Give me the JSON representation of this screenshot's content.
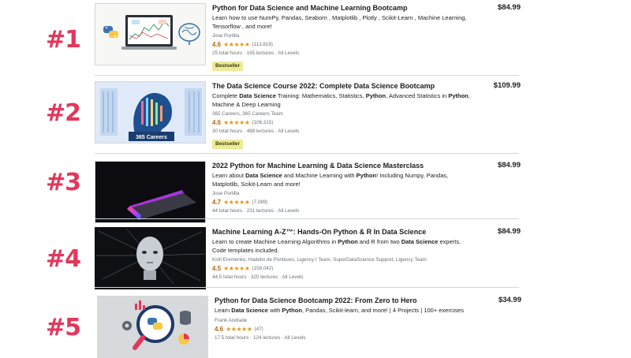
{
  "courses": [
    {
      "rank": "#1",
      "title": "Python for Data Science and Machine Learning Bootcamp",
      "desc": [
        {
          "t": "Learn how to use NumPy, Pandas, Seaborn , Matplotlib , Plotly , Scikit-Learn , Machine Learning, Tensorflow , and more!",
          "b": false
        }
      ],
      "instructor": "Jose Portilla",
      "rating": "4.6",
      "stars": "★★★★★",
      "rating_count": "(113,818)",
      "meta": "25 total hours · 165 lectures · All Levels",
      "badge": "Bestseller",
      "price": "$84.99"
    },
    {
      "rank": "#2",
      "title": "The Data Science Course 2022: Complete Data Science Bootcamp",
      "desc": [
        {
          "t": "Complete ",
          "b": false
        },
        {
          "t": "Data Science",
          "b": true
        },
        {
          "t": " Training: Mathematics, Statistics, ",
          "b": false
        },
        {
          "t": "Python",
          "b": true
        },
        {
          "t": ", Advanced Statistics in ",
          "b": false
        },
        {
          "t": "Python",
          "b": true
        },
        {
          "t": ", Machine & Deep Learning",
          "b": false
        }
      ],
      "thumb_label": "365 Careers",
      "instructor": "365 Careers, 365 Careers Team",
      "rating": "4.6",
      "stars": "★★★★★",
      "rating_count": "(106,315)",
      "meta": "30 total hours · 488 lectures · All Levels",
      "badge": "Bestseller",
      "price": "$109.99"
    },
    {
      "rank": "#3",
      "title": "2022 Python for Machine Learning & Data Science Masterclass",
      "desc": [
        {
          "t": "Learn about ",
          "b": false
        },
        {
          "t": "Data Science",
          "b": true
        },
        {
          "t": " and Machine Learning with ",
          "b": false
        },
        {
          "t": "Python",
          "b": true
        },
        {
          "t": "! Including Numpy, Pandas, Matplotlib, Scikit-Learn and more!",
          "b": false
        }
      ],
      "instructor": "Jose Portilla",
      "rating": "4.7",
      "stars": "★★★★★",
      "rating_count": "(7,089)",
      "meta": "44 total hours · 231 lectures · All Levels",
      "badge": "",
      "price": "$84.99"
    },
    {
      "rank": "#4",
      "title": "Machine Learning A-Z™: Hands-On Python & R In Data Science",
      "desc": [
        {
          "t": "Learn to create Machine Learning Algorithms in ",
          "b": false
        },
        {
          "t": "Python",
          "b": true
        },
        {
          "t": " and R from two ",
          "b": false
        },
        {
          "t": "Data Science",
          "b": true
        },
        {
          "t": " experts. Code templates included.",
          "b": false
        }
      ],
      "instructor": "Kirill Eremenko, Hadelin de Ponteves, Ligency I Team, SuperDataScience Support, Ligency Team",
      "rating": "4.5",
      "stars": "★★★★★",
      "rating_count": "(158,042)",
      "meta": "44.5 total hours · 320 lectures · All Levels",
      "badge": "",
      "price": "$84.99"
    },
    {
      "rank": "#5",
      "title": "Python for Data Science Bootcamp 2022: From Zero to Hero",
      "desc": [
        {
          "t": "Learn ",
          "b": false
        },
        {
          "t": "Data Science",
          "b": true
        },
        {
          "t": " with ",
          "b": false
        },
        {
          "t": "Python",
          "b": true
        },
        {
          "t": ", Pandas, Scikit-learn, and more! | 4 Projects | 100+ exercises",
          "b": false
        }
      ],
      "instructor": "Frank Andrade",
      "rating": "4.6",
      "stars": "★★★★★",
      "rating_count": "(47)",
      "meta": "17.5 total hours · 124 lectures · All Levels",
      "badge": "",
      "price": "$34.99"
    }
  ],
  "colors": {
    "rank": "#e3375c",
    "rating": "#b4690e",
    "star": "#e59819",
    "badge_bg": "#eceb98",
    "divider": "#d1d7dc"
  }
}
